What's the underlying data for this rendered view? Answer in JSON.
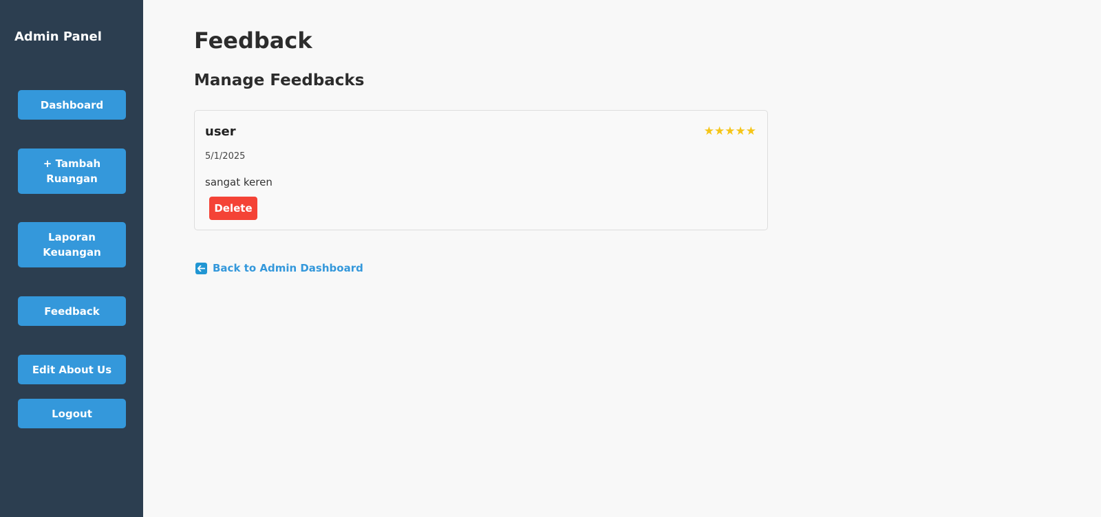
{
  "sidebar": {
    "title": "Admin Panel",
    "items": [
      {
        "label": "Dashboard"
      },
      {
        "label": "+ Tambah Ruangan"
      },
      {
        "label": "Laporan Keuangan"
      },
      {
        "label": "Feedback"
      },
      {
        "label": "Edit About Us"
      },
      {
        "label": "Logout"
      }
    ]
  },
  "main": {
    "title": "Feedback",
    "section_title": "Manage Feedbacks",
    "feedbacks": [
      {
        "user": "user",
        "rating": 5,
        "stars": "★★★★★",
        "date": "5/1/2025",
        "comment": "sangat keren",
        "delete_label": "Delete"
      }
    ],
    "back_link": {
      "label": "Back to Admin Dashboard",
      "icon": "arrow-left-icon"
    }
  },
  "colors": {
    "sidebar_bg": "#2c3e50",
    "button_bg": "#3498db",
    "delete_bg": "#f44336",
    "star": "#f5c518",
    "link": "#3498db"
  }
}
